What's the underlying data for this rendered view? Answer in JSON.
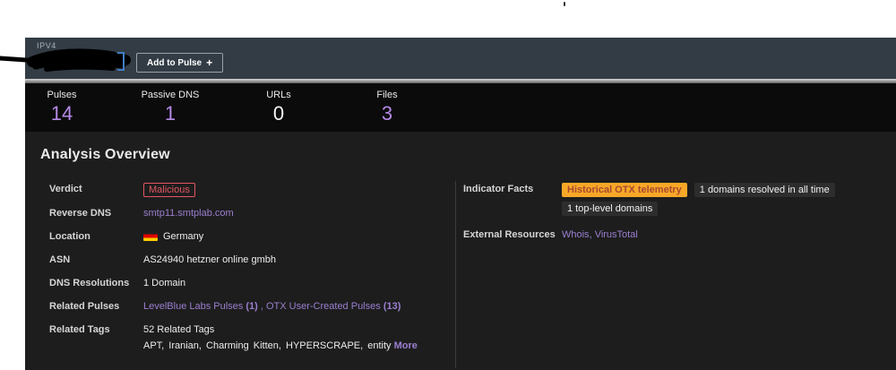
{
  "header": {
    "type_label": "IPV4",
    "add_to_pulse": {
      "label": "Add to Pulse",
      "icon": "+"
    }
  },
  "stats": [
    {
      "label": "Pulses",
      "value": "14"
    },
    {
      "label": "Passive DNS",
      "value": "1"
    },
    {
      "label": "URLs",
      "value": "0"
    },
    {
      "label": "Files",
      "value": "3"
    }
  ],
  "analysis": {
    "title": "Analysis Overview",
    "verdict": {
      "label": "Verdict",
      "badge": "Malicious"
    },
    "reverse_dns": {
      "label": "Reverse DNS",
      "value": "smtp11.smtplab.com"
    },
    "location": {
      "label": "Location",
      "country": "Germany"
    },
    "asn": {
      "label": "ASN",
      "value": "AS24940 hetzner online gmbh"
    },
    "dns_resolutions": {
      "label": "DNS Resolutions",
      "value": "1 Domain"
    },
    "related_pulses": {
      "label": "Related Pulses",
      "link1": "LevelBlue Labs Pulses ",
      "count1": "(1)",
      "separator": " , ",
      "link2": "OTX User-Created Pulses ",
      "count2": "(13)"
    },
    "related_tags": {
      "label": "Related Tags",
      "summary": "52 Related Tags",
      "tags": "APT,  Iranian,  Charming Kitten,  HYPERSCRAPE,  entity",
      "more_label": "More"
    },
    "indicator_facts": {
      "label": "Indicator Facts",
      "badge": "Historical OTX telemetry",
      "fact1": "1 domains resolved in all time",
      "fact2": "1 top-level domains"
    },
    "external_resources": {
      "label": "External Resources",
      "link1": "Whois",
      "separator": ", ",
      "link2": "VirusTotal"
    }
  },
  "colors": {
    "header_slate": "#333c45",
    "stats_black": "#0b0b0b",
    "panel_dark": "#1d1d1d",
    "accent_purple": "#b58ae6",
    "link_purple": "#9b7fd0",
    "malicious_red": "#e25663",
    "telemetry_orange": "#f7a827",
    "chip_gray": "#2d2d2d"
  }
}
